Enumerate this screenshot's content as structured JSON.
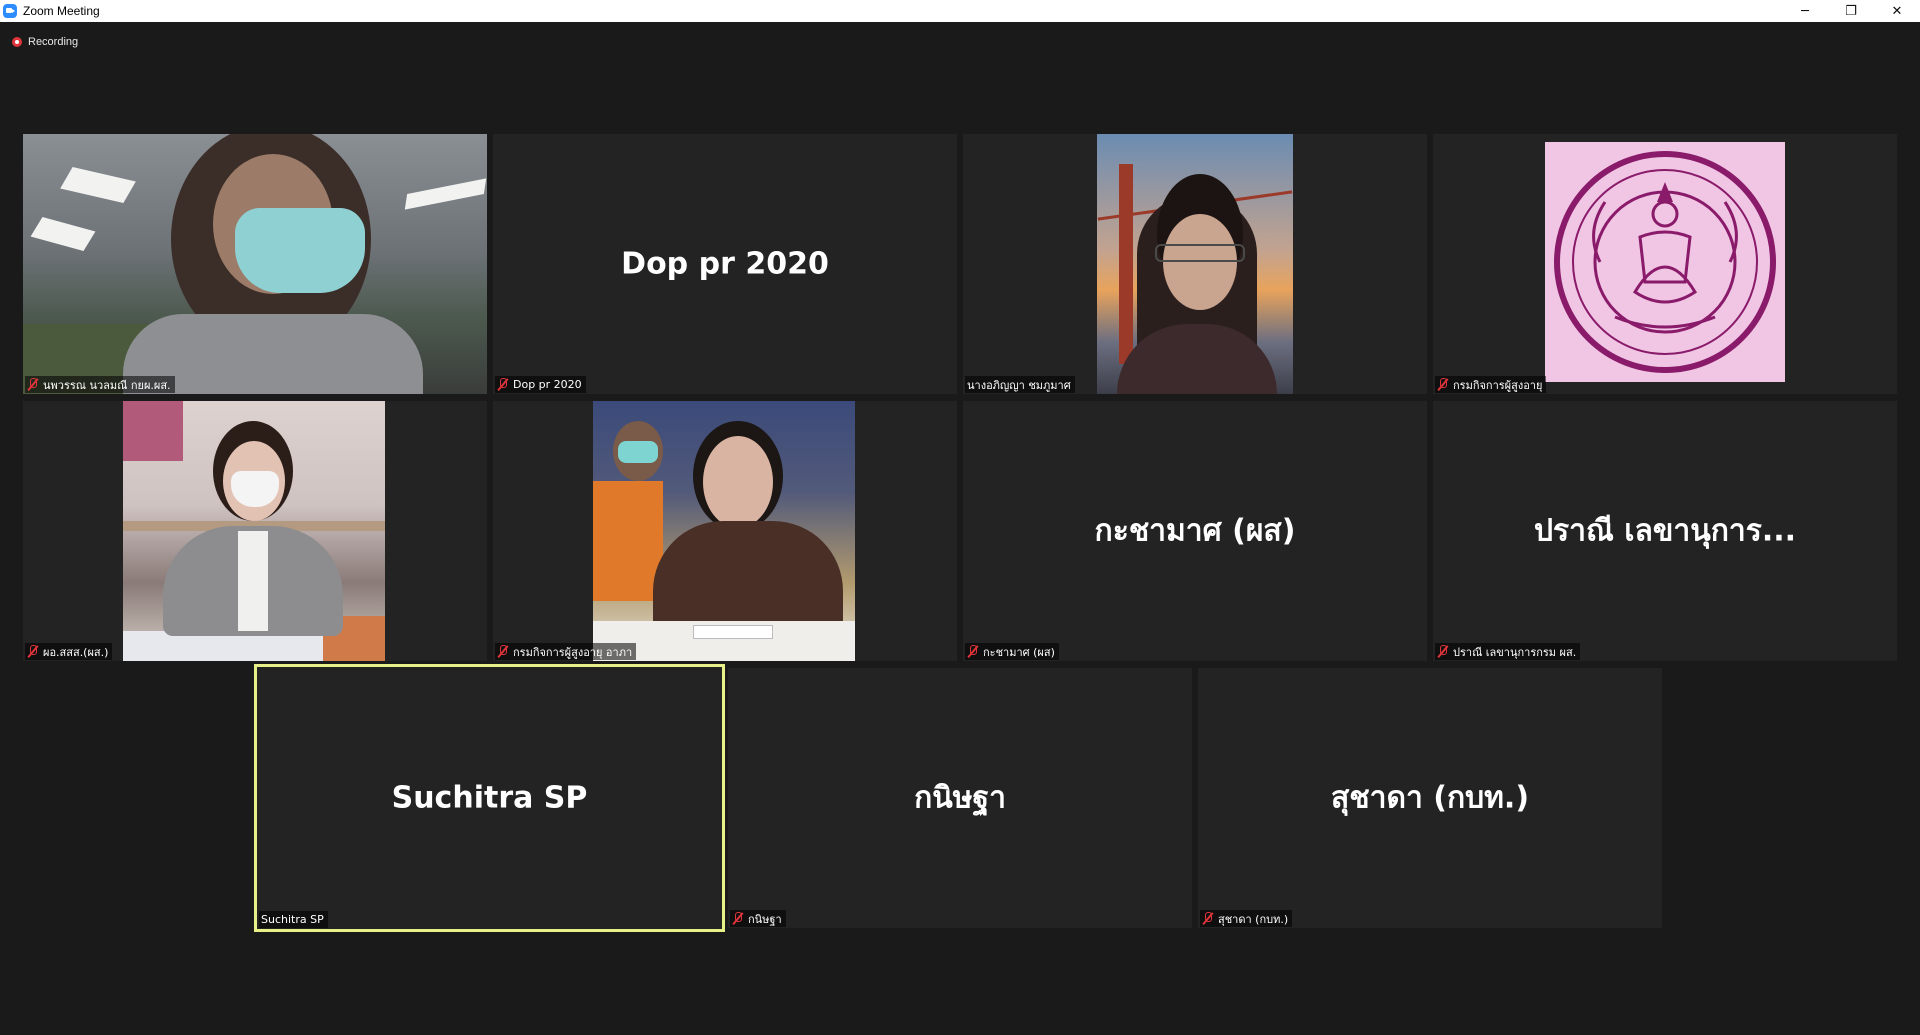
{
  "window": {
    "title": "Zoom Meeting",
    "controls": {
      "minimize": "─",
      "restore": "❐",
      "close": "✕"
    }
  },
  "recording": {
    "label": "Recording",
    "color": "#e0343a"
  },
  "active_speaker_color": "#e8f088",
  "tiles": [
    {
      "display": "",
      "tag": "นพวรรณ นวลมณี กยผ.ผส.",
      "muted": true,
      "video": "webcam-office"
    },
    {
      "display": "Dop pr 2020",
      "tag": "Dop pr 2020",
      "muted": true,
      "video": "none"
    },
    {
      "display": "",
      "tag": "นางอภิญญา ชมภูมาศ",
      "muted": false,
      "video": "bridge-background"
    },
    {
      "display": "",
      "tag": "กรมกิจการผู้สูงอายุ",
      "muted": true,
      "video": "department-seal"
    },
    {
      "display": "",
      "tag": "ผอ.สสส.(ผส.)",
      "muted": true,
      "video": "woman-conference"
    },
    {
      "display": "",
      "tag": "กรมกิจการผู้สูงอายุ อาภา",
      "muted": true,
      "video": "woman-microphone"
    },
    {
      "display": "กะชามาศ (ผส)",
      "tag": "กะชามาศ (ผส)",
      "muted": true,
      "video": "none"
    },
    {
      "display": "ปราณี เลขานุการ...",
      "tag": "ปราณี เลขานุการกรม ผส.",
      "muted": true,
      "video": "none"
    },
    {
      "display": "Suchitra SP",
      "tag": "Suchitra SP",
      "muted": false,
      "video": "none",
      "active": true
    },
    {
      "display": "กนิษฐา",
      "tag": "กนิษฐา",
      "muted": true,
      "video": "none"
    },
    {
      "display": "สุชาดา (กบท.)",
      "tag": "สุชาดา (กบท.)",
      "muted": true,
      "video": "none"
    }
  ]
}
